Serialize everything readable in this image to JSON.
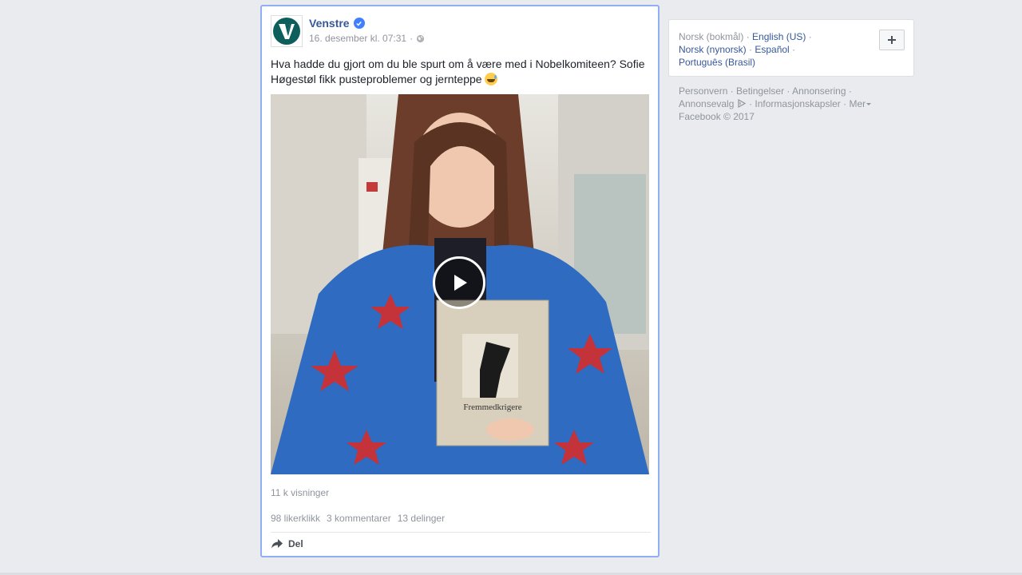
{
  "post": {
    "page_name": "Venstre",
    "timestamp": "16. desember kl. 07:31",
    "separator": "·",
    "text": "Hva hadde du gjort om du ble spurt om å være med i Nobelkomiteen? Sofie Høgestøl fikk pusteproblemer og jernteppe",
    "video": {
      "book_title": "Fremmedkrigere"
    },
    "views": "11 k visninger",
    "likes": "98 likerklikk",
    "comments": "3 kommentarer",
    "shares": "13 delinger",
    "share_label": "Del",
    "avatar_letter": "V"
  },
  "languages": {
    "current": "Norsk (bokmål)",
    "english": "English (US)",
    "nynorsk": "Norsk (nynorsk)",
    "spanish": "Español",
    "portuguese": "Português (Brasil)"
  },
  "footer": {
    "privacy": "Personvern",
    "terms": "Betingelser",
    "advertising": "Annonsering",
    "ad_choices": "Annonsevalg",
    "cookies": "Informasjonskapsler",
    "more": "Mer",
    "copyright": "Facebook © 2017"
  },
  "colors": {
    "link": "#365899",
    "muted": "#90949c",
    "brand_green": "#0e5e5c",
    "highlight_border": "#8fb0f0"
  },
  "icons": {
    "verified": "verified-badge-icon",
    "globe": "globe-icon",
    "play": "play-icon",
    "share": "share-arrow-icon",
    "add": "plus-icon",
    "adchoices": "adchoices-icon"
  }
}
